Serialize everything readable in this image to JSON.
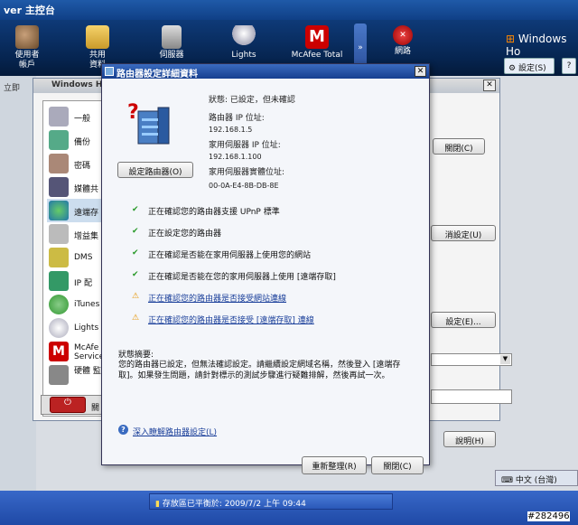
{
  "console": {
    "title": "ver 主控台",
    "toolbar": [
      {
        "label": "使用者\n帳戶",
        "icon": "users-icon"
      },
      {
        "label": "共用\n資料",
        "icon": "shared-folder-icon"
      },
      {
        "label": "伺服器",
        "icon": "server-icon"
      },
      {
        "label": "Lights",
        "icon": "lightbulb-icon"
      },
      {
        "label": "McAfee Total",
        "icon": "mcafee-icon"
      },
      {
        "label": "網路",
        "icon": "network-icon"
      }
    ],
    "logo": "Windows Ho",
    "settings_label": "設定(S)",
    "help_label": "?",
    "left_stub": "立即"
  },
  "settings_dialog": {
    "title": "Windows Ho",
    "items": [
      "一般",
      "備份",
      "密碼",
      "媒體共",
      "遠端存",
      "增益集",
      "DMS",
      "IP 配",
      "iTunes",
      "Lights",
      "McAfe Service",
      "硬體 監控"
    ],
    "buttons": {
      "close": "關閉(C)",
      "cancel": "消設定(U)",
      "settings": "設定(E)...",
      "help": "說明(H)"
    },
    "shutdown_label": "關"
  },
  "router_dialog": {
    "title": "路由器設定詳細資料",
    "configure_button": "設定路由器(O)",
    "status_line": "狀態: 已設定，但未確認",
    "router_ip_label": "路由器 IP 位址:",
    "router_ip": "192.168.1.5",
    "server_ip_label": "家用伺服器 IP 位址:",
    "server_ip": "192.168.1.100",
    "mac_label": "家用伺服器實體位址:",
    "mac": "00-0A-E4-8B-DB-8E",
    "checks": [
      {
        "status": "ok",
        "text": "正在確認您的路由器支援 UPnP 標準"
      },
      {
        "status": "ok",
        "text": "正在設定您的路由器"
      },
      {
        "status": "ok",
        "text": "正在確認是否能在家用伺服器上使用您的網站"
      },
      {
        "status": "ok",
        "text": "正在確認是否能在您的家用伺服器上使用 [遠端存取]"
      },
      {
        "status": "warn",
        "text": "正在確認您的路由器是否接受網站連線"
      },
      {
        "status": "warn",
        "text": "正在確認您的路由器是否接受 [遠端存取] 連線"
      }
    ],
    "summary_label": "狀態摘要:",
    "summary_text": "您的路由器已設定，但無法確認設定。請繼續設定網域名稱，然後登入 [遠端存取]。如果發生問題，請針對標示的測試步驟進行疑難排解，然後再試一次。",
    "learn_more": "深入瞭解路由器設定(L)",
    "refresh_button": "重新整理(R)",
    "close_button": "關閉(C)"
  },
  "taskbar": {
    "lang": "中文 (台灣)",
    "status": "存放區已平衡於: 2009/7/2 上午 09:44"
  },
  "watermark": "#282496"
}
